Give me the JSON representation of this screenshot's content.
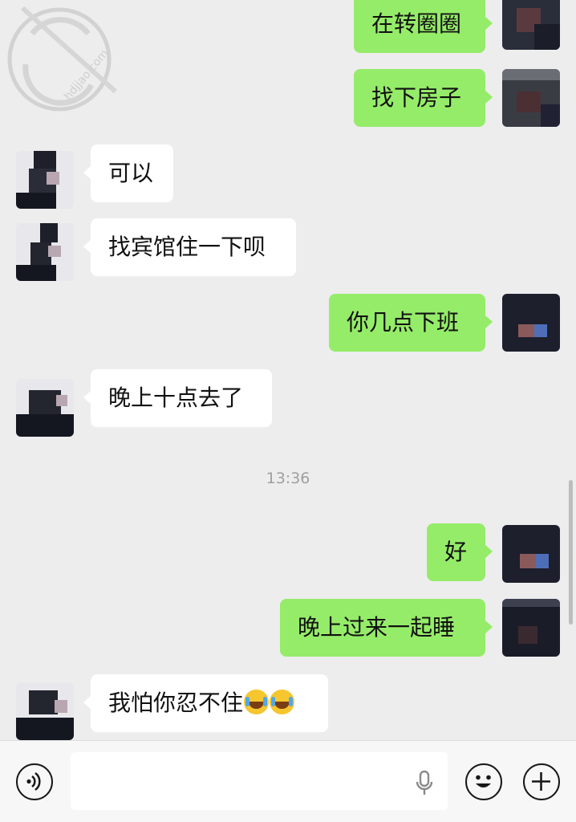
{
  "messages": [
    {
      "side": "out",
      "text": "在转圈圈"
    },
    {
      "side": "out",
      "text": "找下房子"
    },
    {
      "side": "in",
      "text": "可以"
    },
    {
      "side": "in",
      "text": "找宾馆住一下呗"
    },
    {
      "side": "out",
      "text": "你几点下班"
    },
    {
      "side": "in",
      "text": "晚上十点去了"
    },
    {
      "side": "out",
      "text": "好"
    },
    {
      "side": "out",
      "text": "晚上过来一起睡"
    },
    {
      "side": "in",
      "text": "我怕你忍不住"
    }
  ],
  "timestamp": "13:36",
  "emoji": [
    "crying-laughing-emoji",
    "crying-laughing-emoji"
  ],
  "watermark": {
    "text": "hdjjao.com"
  },
  "input_bar": {
    "voice_icon": "voice-mode-icon",
    "mic_icon": "microphone-icon",
    "emoji_icon": "smiley-icon",
    "plus_icon": "plus-icon",
    "placeholder": ""
  },
  "colors": {
    "background": "#ededed",
    "outgoing_bubble": "#95ec69",
    "incoming_bubble": "#ffffff",
    "timestamp": "#9f9f9f"
  }
}
